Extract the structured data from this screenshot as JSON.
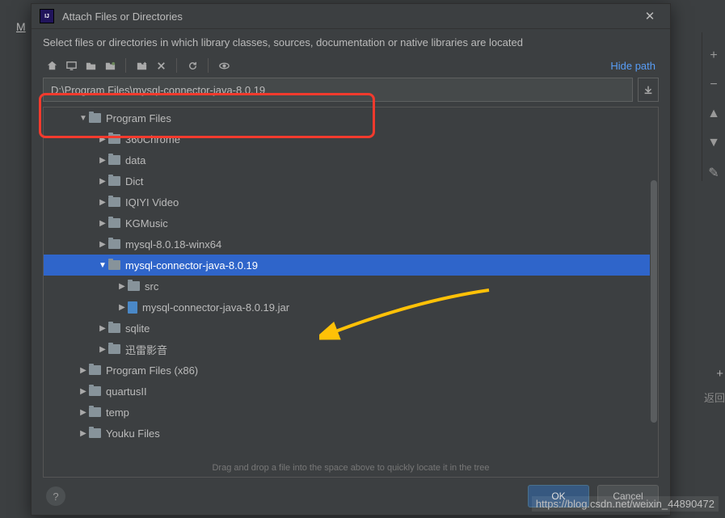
{
  "dialog": {
    "title": "Attach Files or Directories",
    "subtitle": "Select files or directories in which library classes, sources, documentation or native libraries are located",
    "hide_path": "Hide path",
    "path_value": "D:\\Program Files\\mysql-connector-java-8.0.19",
    "drag_hint": "Drag and drop a file into the space above to quickly locate it in the tree",
    "ok": "OK",
    "cancel": "Cancel",
    "help": "?"
  },
  "tree": [
    {
      "indent": 1,
      "expanded": true,
      "icon": "folder",
      "label": "Program Files",
      "selected": false
    },
    {
      "indent": 2,
      "expanded": false,
      "icon": "folder",
      "label": "360Chrome",
      "selected": false
    },
    {
      "indent": 2,
      "expanded": false,
      "icon": "folder",
      "label": "data",
      "selected": false
    },
    {
      "indent": 2,
      "expanded": false,
      "icon": "folder",
      "label": "Dict",
      "selected": false
    },
    {
      "indent": 2,
      "expanded": false,
      "icon": "folder",
      "label": "IQIYI Video",
      "selected": false
    },
    {
      "indent": 2,
      "expanded": false,
      "icon": "folder",
      "label": "KGMusic",
      "selected": false
    },
    {
      "indent": 2,
      "expanded": false,
      "icon": "folder",
      "label": "mysql-8.0.18-winx64",
      "selected": false
    },
    {
      "indent": 2,
      "expanded": true,
      "icon": "folder",
      "label": "mysql-connector-java-8.0.19",
      "selected": true
    },
    {
      "indent": 3,
      "expanded": false,
      "icon": "folder",
      "label": "src",
      "selected": false
    },
    {
      "indent": 3,
      "expanded": false,
      "icon": "jar",
      "label": "mysql-connector-java-8.0.19.jar",
      "selected": false
    },
    {
      "indent": 2,
      "expanded": false,
      "icon": "folder",
      "label": "sqlite",
      "selected": false
    },
    {
      "indent": 2,
      "expanded": false,
      "icon": "folder",
      "label": "迅雷影音",
      "selected": false
    },
    {
      "indent": 1,
      "expanded": false,
      "icon": "folder",
      "label": "Program Files (x86)",
      "selected": false
    },
    {
      "indent": 1,
      "expanded": false,
      "icon": "folder",
      "label": "quartusII",
      "selected": false
    },
    {
      "indent": 1,
      "expanded": false,
      "icon": "folder",
      "label": "temp",
      "selected": false
    },
    {
      "indent": 1,
      "expanded": false,
      "icon": "folder",
      "label": "Youku Files",
      "selected": false
    }
  ],
  "watermark": "https://blog.csdn.net/weixin_44890472",
  "left_edge": "M",
  "right_rail": {
    "plus": "+",
    "minus": "−",
    "up": "▲",
    "down": "▼",
    "pencil": "✎"
  }
}
